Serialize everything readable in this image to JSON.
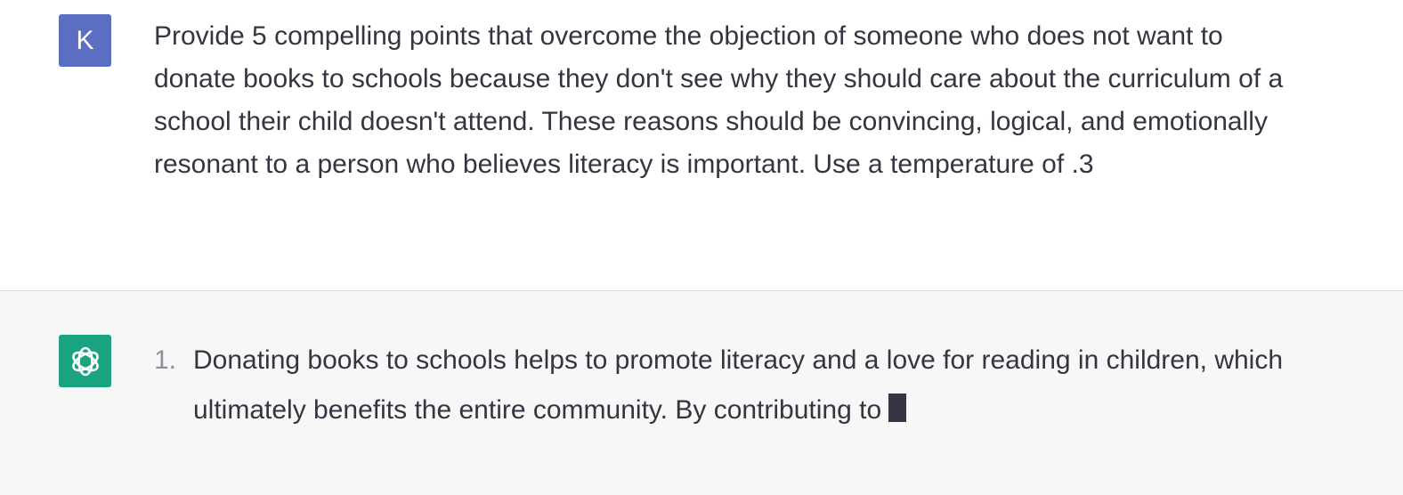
{
  "conversation": {
    "user": {
      "avatar_letter": "K",
      "avatar_color": "#5a6fc2",
      "message": "Provide 5 compelling points that overcome the objection of someone who does not want to donate books to schools because they don't see why they should care about the curriculum of a school their child doesn't attend. These reasons should be convincing, logical, and emotionally resonant to a person who believes literacy is important. Use a temperature of .3"
    },
    "assistant": {
      "avatar_icon": "openai-logo-icon",
      "avatar_color": "#19a37f",
      "items": [
        {
          "number": "1.",
          "text": "Donating books to schools helps to promote literacy and a love for reading in children, which ultimately benefits the entire community. By contributing to"
        }
      ]
    }
  }
}
